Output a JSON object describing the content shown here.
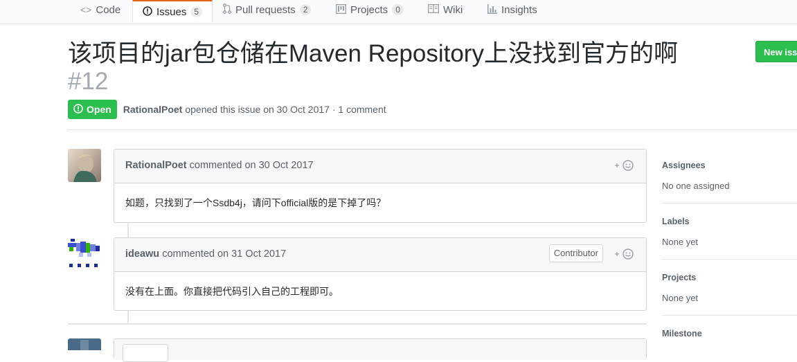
{
  "repo_nav": {
    "tabs": [
      {
        "label": "Code",
        "icon": "code-icon"
      },
      {
        "label": "Issues",
        "icon": "issue-opened-icon",
        "count": "5"
      },
      {
        "label": "Pull requests",
        "icon": "git-pull-request-icon",
        "count": "2"
      },
      {
        "label": "Projects",
        "icon": "project-icon",
        "count": "0"
      },
      {
        "label": "Wiki",
        "icon": "book-icon"
      },
      {
        "label": "Insights",
        "icon": "graph-icon"
      }
    ]
  },
  "issue": {
    "title": "该项目的jar包仓储在Maven Repository上没找到官方的啊",
    "number": "#12",
    "state": "Open",
    "author": "RationalPoet",
    "opened_text": "opened this issue on 30 Oct 2017 · 1 comment",
    "new_issue_label": "New issue"
  },
  "comments": [
    {
      "author": "RationalPoet",
      "action": "commented on 30 Oct 2017",
      "body": "如题，只找到了一个Ssdb4j，请问下official版的是下掉了吗？",
      "badge": ""
    },
    {
      "author": "ideawu",
      "action": "commented on 31 Oct 2017",
      "body": "没有在上面。你直接把代码引入自己的工程即可。",
      "badge": "Contributor"
    }
  ],
  "sidebar": {
    "assignees_label": "Assignees",
    "assignees_value": "No one assigned",
    "labels_label": "Labels",
    "labels_value": "None yet",
    "projects_label": "Projects",
    "projects_value": "None yet",
    "milestone_label": "Milestone"
  },
  "colors": {
    "open_green": "#2cbe4e",
    "accent_orange": "#e36209"
  }
}
